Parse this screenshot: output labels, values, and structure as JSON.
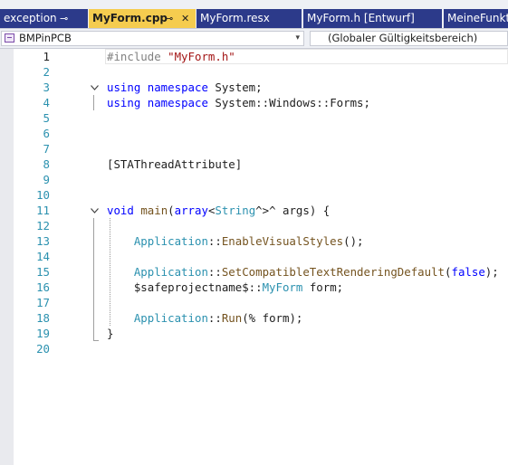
{
  "tabs": [
    {
      "label": "exception",
      "pinned": true
    },
    {
      "label": "MyForm.cpp",
      "active": true
    },
    {
      "label": "MyForm.resx"
    },
    {
      "label": "MyForm.h [Entwurf]"
    },
    {
      "label": "MeineFunkti"
    }
  ],
  "icons": {
    "pin": "⊸",
    "close": "✕",
    "dropdown": "▾"
  },
  "navbar": {
    "project": "BMPinPCB",
    "scope": "(Globaler Gültigkeitsbereich)"
  },
  "editor": {
    "current_line": 1,
    "lines": [
      {
        "n": "1",
        "tokens": [
          {
            "t": "#include ",
            "c": "pp"
          },
          {
            "t": "\"MyForm.h\"",
            "c": "str"
          }
        ]
      },
      {
        "n": "2",
        "tokens": []
      },
      {
        "n": "3",
        "fold": "v",
        "tokens": [
          {
            "t": "using ",
            "c": "kw"
          },
          {
            "t": "namespace ",
            "c": "kw"
          },
          {
            "t": "System;",
            "c": ""
          }
        ]
      },
      {
        "n": "4",
        "tokens": [
          {
            "t": "using ",
            "c": "kw"
          },
          {
            "t": "namespace ",
            "c": "kw"
          },
          {
            "t": "System",
            "c": ""
          },
          {
            "t": "::",
            "c": ""
          },
          {
            "t": "Windows",
            "c": ""
          },
          {
            "t": "::",
            "c": ""
          },
          {
            "t": "Forms;",
            "c": ""
          }
        ]
      },
      {
        "n": "5",
        "tokens": []
      },
      {
        "n": "6",
        "tokens": []
      },
      {
        "n": "7",
        "tokens": []
      },
      {
        "n": "8",
        "tokens": [
          {
            "t": "[STAThreadAttribute]",
            "c": ""
          }
        ]
      },
      {
        "n": "9",
        "tokens": []
      },
      {
        "n": "10",
        "tokens": []
      },
      {
        "n": "11",
        "fold": "v",
        "tokens": [
          {
            "t": "void ",
            "c": "kw"
          },
          {
            "t": "main",
            "c": "fn"
          },
          {
            "t": "(",
            "c": ""
          },
          {
            "t": "array",
            "c": "kw"
          },
          {
            "t": "<",
            "c": ""
          },
          {
            "t": "String",
            "c": "typ"
          },
          {
            "t": "^>^ ",
            "c": ""
          },
          {
            "t": "args",
            "c": ""
          },
          {
            "t": ") {",
            "c": ""
          }
        ]
      },
      {
        "n": "12",
        "tokens": []
      },
      {
        "n": "13",
        "tokens": [
          {
            "t": "    ",
            "c": ""
          },
          {
            "t": "Application",
            "c": "typ"
          },
          {
            "t": "::",
            "c": ""
          },
          {
            "t": "EnableVisualStyles",
            "c": "fn"
          },
          {
            "t": "();",
            "c": ""
          }
        ]
      },
      {
        "n": "14",
        "tokens": []
      },
      {
        "n": "15",
        "tokens": [
          {
            "t": "    ",
            "c": ""
          },
          {
            "t": "Application",
            "c": "typ"
          },
          {
            "t": "::",
            "c": ""
          },
          {
            "t": "SetCompatibleTextRenderingDefault",
            "c": "fn"
          },
          {
            "t": "(",
            "c": ""
          },
          {
            "t": "false",
            "c": "kw"
          },
          {
            "t": ");",
            "c": ""
          }
        ]
      },
      {
        "n": "16",
        "tokens": [
          {
            "t": "    ",
            "c": ""
          },
          {
            "t": "$safeprojectname$",
            "c": ""
          },
          {
            "t": "::",
            "c": ""
          },
          {
            "t": "MyForm ",
            "c": "typ"
          },
          {
            "t": "form",
            "c": ""
          },
          {
            "t": ";",
            "c": ""
          }
        ]
      },
      {
        "n": "17",
        "tokens": []
      },
      {
        "n": "18",
        "tokens": [
          {
            "t": "    ",
            "c": ""
          },
          {
            "t": "Application",
            "c": "typ"
          },
          {
            "t": "::",
            "c": ""
          },
          {
            "t": "Run",
            "c": "fn"
          },
          {
            "t": "(% ",
            "c": ""
          },
          {
            "t": "form",
            "c": ""
          },
          {
            "t": ");",
            "c": ""
          }
        ]
      },
      {
        "n": "19",
        "tokens": [
          {
            "t": "}",
            "c": ""
          }
        ]
      },
      {
        "n": "20",
        "tokens": []
      }
    ]
  },
  "colors": {
    "tab_active": "#f5cc4f",
    "tab_inactive": "#2c3a8a",
    "keyword": "#0000ff",
    "string": "#a31515",
    "type": "#2b91af",
    "function": "#74531f",
    "line_number": "#2b91af"
  }
}
